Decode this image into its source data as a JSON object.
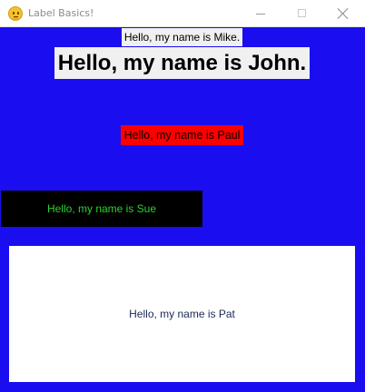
{
  "window": {
    "title": "Label Basics!",
    "icon": "thinking-face-icon",
    "background_color": "#1a0ef0"
  },
  "labels": {
    "mike": {
      "text": "Hello, my name is Mike.",
      "bg": "#f0f0f0",
      "fg": "#000000"
    },
    "john": {
      "text": "Hello, my name is John.",
      "bg": "#f0f0f0",
      "fg": "#000000"
    },
    "paul": {
      "text": "Hello, my name is Paul",
      "bg": "#ff0000",
      "fg": "#000000"
    },
    "sue": {
      "text": "Hello, my name is Sue",
      "bg": "#000000",
      "fg": "#2bd12b"
    },
    "pat": {
      "text": "Hello, my name is Pat",
      "bg": "#ffffff",
      "fg": "#1a2a55"
    }
  }
}
